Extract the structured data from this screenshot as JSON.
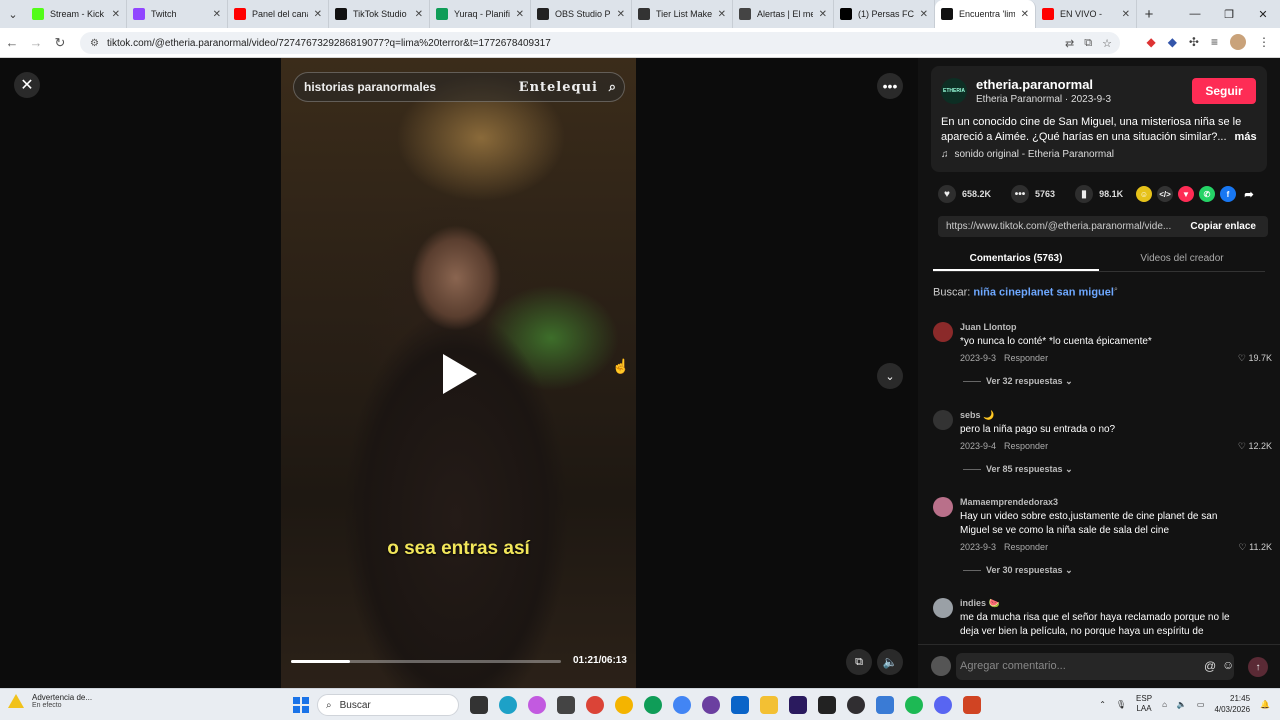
{
  "browser": {
    "tabs": [
      {
        "title": "Stream - Kick",
        "color": "#53fc18"
      },
      {
        "title": "Twitch",
        "color": "#9146ff"
      },
      {
        "title": "Panel del canal",
        "color": "#ff0000"
      },
      {
        "title": "TikTok Studio",
        "color": "#111111"
      },
      {
        "title": "Yuraq - Planific",
        "color": "#0f9d58"
      },
      {
        "title": "OBS Studio Pl",
        "color": "#222222"
      },
      {
        "title": "Tier List Maker",
        "color": "#333333"
      },
      {
        "title": "Alertas | El me",
        "color": "#444444"
      },
      {
        "title": "(1) Persas FC (",
        "color": "#000000"
      },
      {
        "title": "Encuentra 'lim",
        "color": "#111111",
        "active": true
      },
      {
        "title": "EN VIVO -",
        "color": "#ff0000"
      }
    ],
    "new_tab": "+",
    "url": "tiktok.com/@etheria.paranormal/video/7274767329286819077?q=lima%20terror&t=1772678409317"
  },
  "video": {
    "search_text": "historias paranormales",
    "watermark": "Entelequi",
    "caption": "o sea entras así",
    "timecode": "01:21/06:13",
    "progress": 0.22
  },
  "post": {
    "account_name": "etheria.paranormal",
    "account_sub": "Etheria Paranormal · 2023-9-3",
    "avatar_text": "ETHERIA",
    "follow_label": "Seguir",
    "description": "En un conocido cine de San Miguel, una misteriosa niña se le apareció a Aimée. ¿Qué harías en una situación similar?...",
    "more_label": "más",
    "sound": "sonido original - Etheria Paranormal",
    "likes": "658.2K",
    "comments": "5763",
    "saves": "98.1K",
    "link": "https://www.tiktok.com/@etheria.paranormal/vide...",
    "copy_label": "Copiar enlace"
  },
  "panel_tabs": {
    "comments": "Comentarios (5763)",
    "creator_videos": "Videos del creador"
  },
  "search_suggestion": {
    "prefix": "Buscar:",
    "query": "niña cineplanet san miguel"
  },
  "comments": [
    {
      "user": "Juan Llontop",
      "text": "*yo nunca lo conté* *lo cuenta épicamente*",
      "date": "2023-9-3",
      "reply": "Responder",
      "likes": "19.7K",
      "replies": "Ver 32 respuestas",
      "avatar": "#8b2a2a"
    },
    {
      "user": "sebs 🌙",
      "text": "pero la niña pago su entrada o no?",
      "date": "2023-9-4",
      "reply": "Responder",
      "likes": "12.2K",
      "replies": "Ver 85 respuestas",
      "avatar": "#333333"
    },
    {
      "user": "Mamaemprendedorax3",
      "text": "Hay un video sobre esto,justamente de cine planet de san Miguel se ve como la niña sale de sala del cine",
      "date": "2023-9-3",
      "reply": "Responder",
      "likes": "11.2K",
      "replies": "Ver 30 respuestas",
      "avatar": "#b9708a"
    },
    {
      "user": "indies 🍉",
      "text": "me da mucha risa que el señor haya reclamado porque no le deja ver bien la película, no porque haya un espíritu de",
      "avatar": "#9aa0a6"
    }
  ],
  "add_comment": {
    "placeholder": "Agregar comentario..."
  },
  "taskbar": {
    "warning_title": "Advertencia de...",
    "warning_sub": "En efecto",
    "search_label": "Buscar",
    "lang_1": "ESP",
    "lang_2": "LAA",
    "time": "21:45",
    "date": "4/03/2026"
  }
}
